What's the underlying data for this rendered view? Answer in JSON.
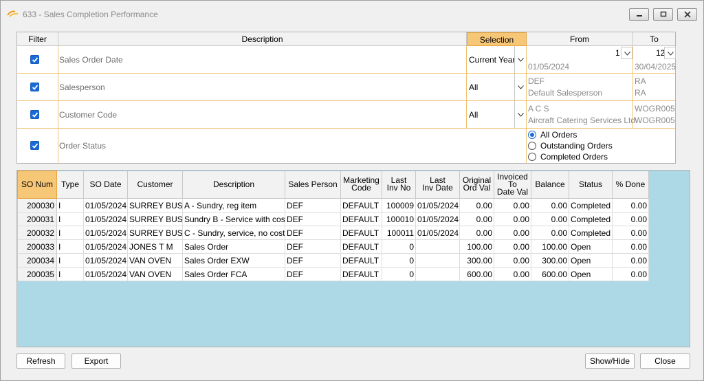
{
  "window": {
    "title": "633 - Sales Completion Performance"
  },
  "filter": {
    "headers": {
      "filter": "Filter",
      "description": "Description",
      "selection": "Selection",
      "from": "From",
      "to": "To"
    },
    "rows": [
      {
        "checked": true,
        "description": "Sales Order Date",
        "selection": "Current Year",
        "from_top": "1",
        "from_bottom": "01/05/2024",
        "to_top": "12",
        "to_bottom": "30/04/2025"
      },
      {
        "checked": true,
        "description": "Salesperson",
        "selection": "All",
        "from_top": "DEF",
        "from_bottom": "Default Salesperson",
        "to_top": "RA",
        "to_bottom": "RA"
      },
      {
        "checked": true,
        "description": "Customer Code",
        "selection": "All",
        "from_top": "A C S",
        "from_bottom": "Aircraft Catering Services Ltd",
        "to_top": "WOGR005",
        "to_bottom": "WOGR005"
      },
      {
        "checked": true,
        "description": "Order Status"
      }
    ],
    "order_status_options": [
      "All Orders",
      "Outstanding Orders",
      "Completed Orders"
    ],
    "order_status_selected": "All Orders"
  },
  "grid": {
    "columns": [
      "SO Num",
      "Type",
      "SO Date",
      "Customer",
      "Description",
      "Sales Person",
      "Marketing Code",
      "Last Inv No",
      "Last Inv Date",
      "Original Ord Val",
      "Invoiced To Date Val",
      "Balance",
      "Status",
      "% Done"
    ],
    "rows": [
      [
        "200030",
        "I",
        "01/05/2024",
        "SURREY BUS",
        "A - Sundry, reg item",
        "DEF",
        "DEFAULT",
        "100009",
        "01/05/2024",
        "0.00",
        "0.00",
        "0.00",
        "Completed",
        "0.00"
      ],
      [
        "200031",
        "I",
        "01/05/2024",
        "SURREY BUS",
        "Sundry B - Service with cost",
        "DEF",
        "DEFAULT",
        "100010",
        "01/05/2024",
        "0.00",
        "0.00",
        "0.00",
        "Completed",
        "0.00"
      ],
      [
        "200032",
        "I",
        "01/05/2024",
        "SURREY BUS",
        "C - Sundry, service, no cost",
        "DEF",
        "DEFAULT",
        "100011",
        "01/05/2024",
        "0.00",
        "0.00",
        "0.00",
        "Completed",
        "0.00"
      ],
      [
        "200033",
        "I",
        "01/05/2024",
        "JONES T M",
        "Sales Order",
        "DEF",
        "DEFAULT",
        "0",
        "",
        "100.00",
        "0.00",
        "100.00",
        "Open",
        "0.00"
      ],
      [
        "200034",
        "I",
        "01/05/2024",
        "VAN OVEN",
        "Sales Order EXW",
        "DEF",
        "DEFAULT",
        "0",
        "",
        "300.00",
        "0.00",
        "300.00",
        "Open",
        "0.00"
      ],
      [
        "200035",
        "I",
        "01/05/2024",
        "VAN OVEN",
        "Sales Order FCA",
        "DEF",
        "DEFAULT",
        "0",
        "",
        "600.00",
        "0.00",
        "600.00",
        "Open",
        "0.00"
      ]
    ]
  },
  "buttons": {
    "refresh": "Refresh",
    "export": "Export",
    "show_hide": "Show/Hide",
    "close": "Close"
  },
  "colors": {
    "accent": "#f7c778",
    "grid_background": "#add8e6",
    "checkbox": "#1a6ad8"
  }
}
